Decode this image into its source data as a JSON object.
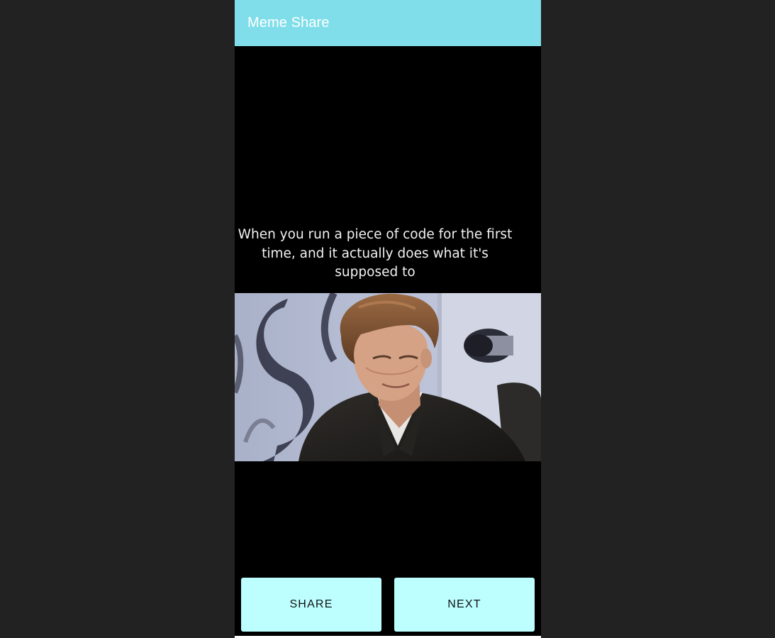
{
  "app_bar": {
    "title": "Meme Share",
    "color": "#80DEEA"
  },
  "meme": {
    "caption": "When you run a piece of code for the first time, and it actually does what it's supposed to",
    "image_description": "man in suit looking down in disbelief"
  },
  "buttons": {
    "share_label": "SHARE",
    "next_label": "NEXT",
    "color": "#BDFFFF"
  },
  "colors": {
    "desktop_background": "#222222",
    "meme_background": "#000000"
  }
}
